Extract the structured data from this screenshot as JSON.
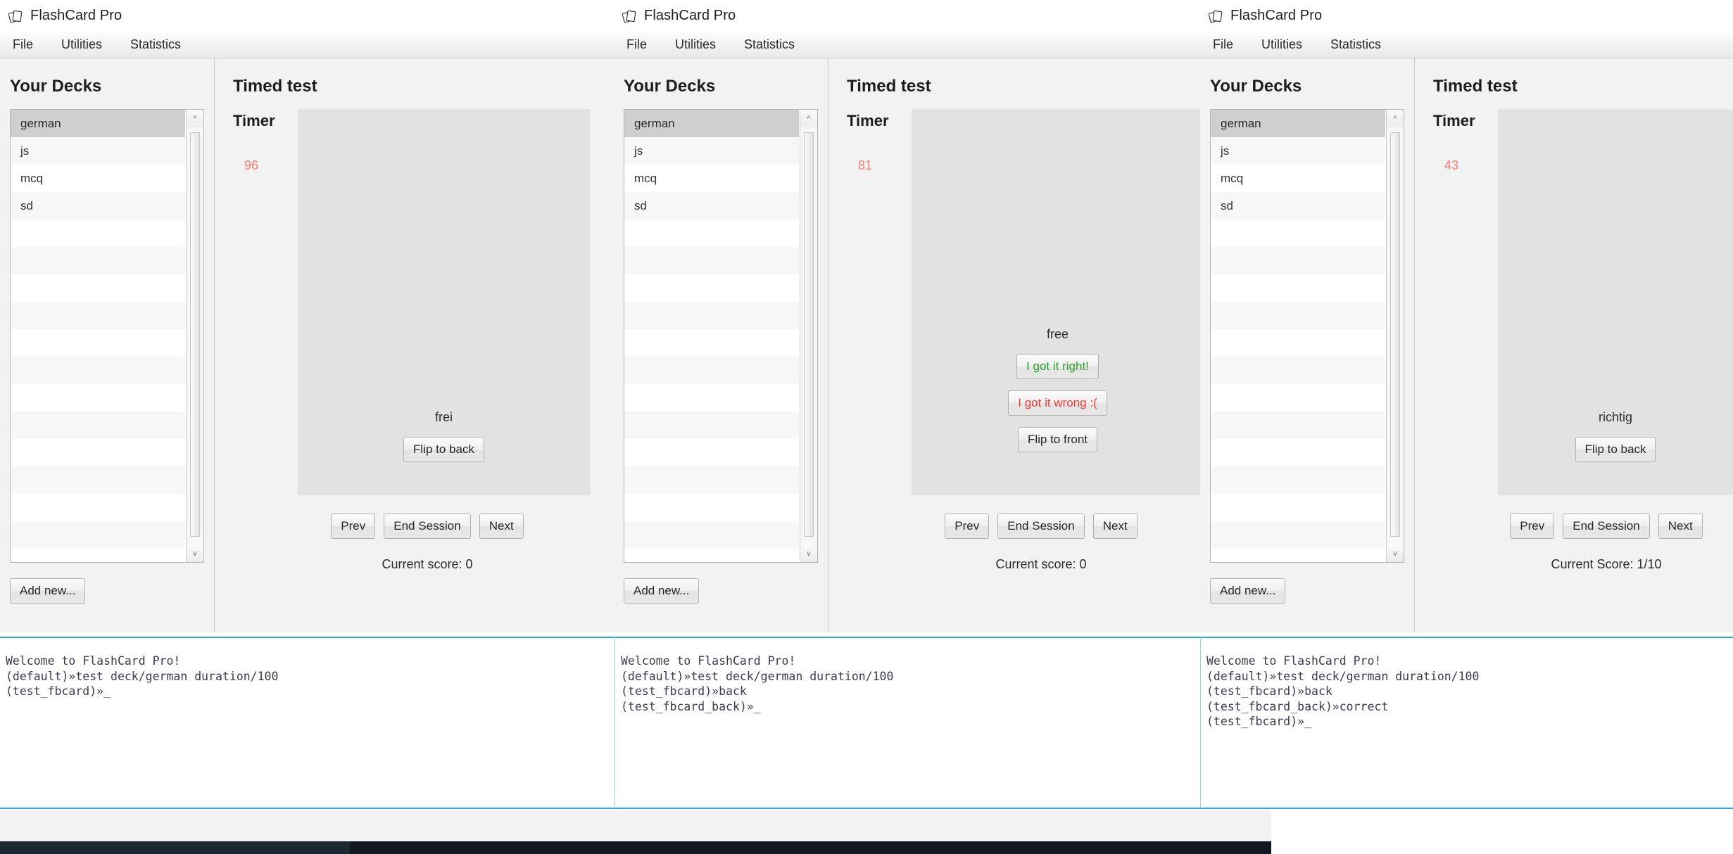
{
  "app": {
    "title": "FlashCard Pro",
    "icon": "cards-icon",
    "menu": [
      "File",
      "Utilities",
      "Statistics"
    ]
  },
  "labels": {
    "decks_heading": "Your Decks",
    "test_heading": "Timed test",
    "timer_heading": "Timer",
    "add_new": "Add new...",
    "prev": "Prev",
    "end_session": "End Session",
    "next": "Next",
    "flip_to_back": "Flip to back",
    "flip_to_front": "Flip to front",
    "got_it_right": "I got it right!",
    "got_it_wrong": "I got it wrong :("
  },
  "decks": [
    {
      "name": "german",
      "selected": true
    },
    {
      "name": "js",
      "selected": false
    },
    {
      "name": "mcq",
      "selected": false
    },
    {
      "name": "sd",
      "selected": false
    }
  ],
  "colors": {
    "timer": "#fa7a6e",
    "correct": "#2aa02a",
    "wrong": "#f03b32",
    "console_border": "#2fa8e0",
    "selection": "#cfcfcf"
  },
  "windows": [
    {
      "id": "win-1",
      "timer_value": "96",
      "card_text": "frei",
      "card_side": "front",
      "score_text": "Current score: 0"
    },
    {
      "id": "win-2",
      "timer_value": "81",
      "card_text": "free",
      "card_side": "back",
      "score_text": "Current score: 0"
    },
    {
      "id": "win-3",
      "timer_value": "43",
      "card_text": "richtig",
      "card_side": "front",
      "score_text": "Current Score: 1/10"
    }
  ],
  "consoles": [
    {
      "id": "console-1",
      "lines": "Welcome to FlashCard Pro!\n(default)»test deck/german duration/100\n(test_fbcard)»_"
    },
    {
      "id": "console-2",
      "lines": "Welcome to FlashCard Pro!\n(default)»test deck/german duration/100\n(test_fbcard)»back\n(test_fbcard_back)»_"
    },
    {
      "id": "console-3",
      "lines": "Welcome to FlashCard Pro!\n(default)»test deck/german duration/100\n(test_fbcard)»back\n(test_fbcard_back)»correct\n(test_fbcard)»_"
    }
  ]
}
